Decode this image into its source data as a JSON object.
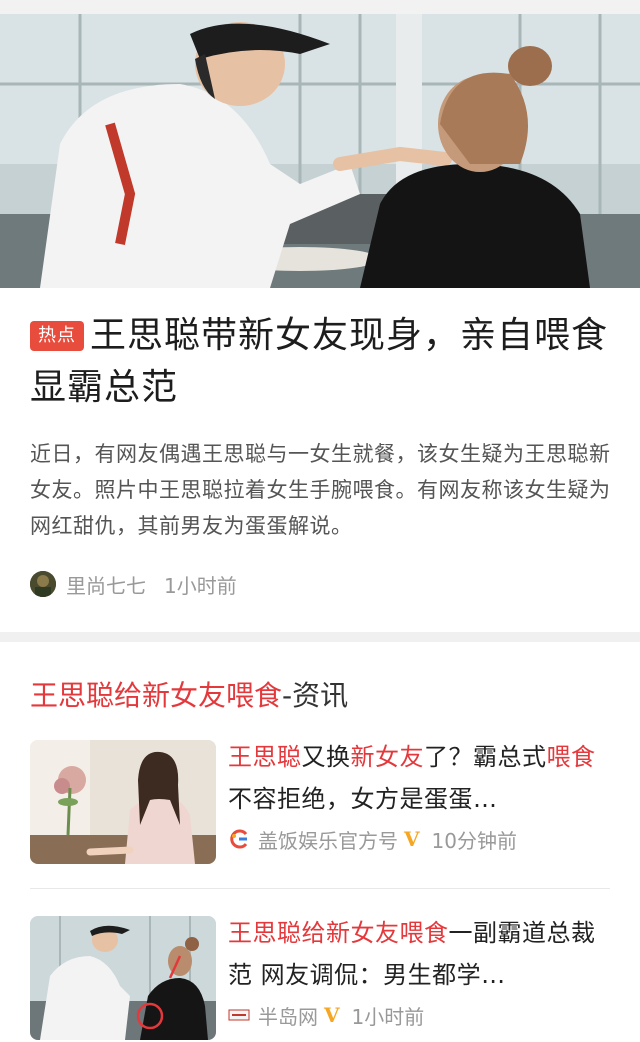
{
  "article": {
    "badge": "热点",
    "title": "王思聪带新女友现身，亲自喂食显霸总范",
    "summary": "近日，有网友偶遇王思聪与一女生就餐，该女生疑为王思聪新女友。照片中王思聪拉着女生手腕喂食。有网友称该女生疑为网红甜仇，其前男友为蛋蛋解说。",
    "source": "里尚七七",
    "time": "1小时前"
  },
  "related": {
    "title_highlight": "王思聪给新女友喂食",
    "title_suffix": "-资讯",
    "items": [
      {
        "title_parts": [
          {
            "text": "王思聪",
            "hl": true
          },
          {
            "text": "又换",
            "hl": false
          },
          {
            "text": "新女友",
            "hl": true
          },
          {
            "text": "了？霸总式",
            "hl": false
          },
          {
            "text": "喂食",
            "hl": true
          },
          {
            "text": "不容拒绝，女方是蛋蛋…",
            "hl": false
          }
        ],
        "source": "盖饭娱乐官方号",
        "verified": "V",
        "time": "10分钟前"
      },
      {
        "title_parts": [
          {
            "text": "王思聪给新女友喂食",
            "hl": true
          },
          {
            "text": "一副霸道总裁范 网友调侃：男生都学…",
            "hl": false
          }
        ],
        "source": "半岛网",
        "verified": "V",
        "time": "1小时前"
      }
    ]
  },
  "colors": {
    "accent": "#e4393c",
    "badge": "#e74c3c",
    "verified": "#f5a623"
  }
}
